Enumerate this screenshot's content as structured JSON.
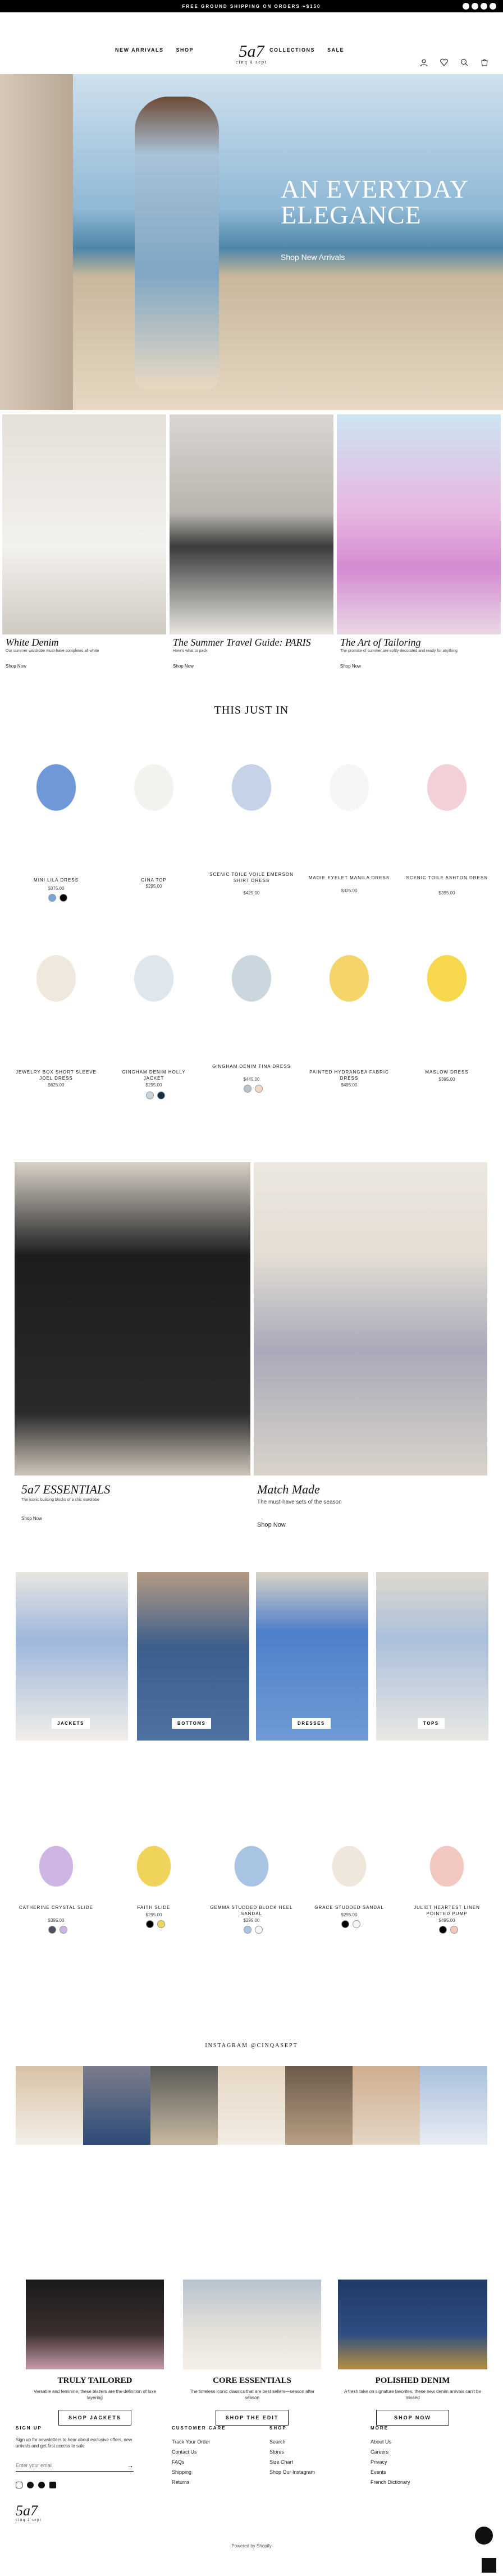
{
  "announcement": "FREE GROUND SHIPPING ON ORDERS +$150",
  "nav_left": [
    "NEW ARRIVALS",
    "SHOP"
  ],
  "nav_right": [
    "COLLECTIONS",
    "SALE"
  ],
  "logo": {
    "main": "5a7",
    "sub": "cinq à sept"
  },
  "header_icons": [
    "account-icon",
    "heart-icon",
    "search-icon",
    "cart-icon"
  ],
  "hero": {
    "title_line1": "AN EVERYDAY",
    "title_line2": "ELEGANCE",
    "cta": "Shop New Arrivals"
  },
  "features": [
    {
      "title": "White Denim",
      "sub": "Our summer wardrobe must-have completes all-white",
      "link": "Shop Now"
    },
    {
      "title": "The Summer Travel Guide: PARIS",
      "sub": "Here's what to pack",
      "link": "Shop Now"
    },
    {
      "title": "The Art of Tailoring",
      "sub": "The promise of summer are softly decorated and ready for anything",
      "link": "Shop Now"
    }
  ],
  "just_in": {
    "title": "THIS JUST IN",
    "row1": [
      {
        "name": "MINI LILA DRESS",
        "price": "$375.00"
      },
      {
        "name": "GINA TOP",
        "price": "$295.00"
      },
      {
        "name": "SCENIC TOILE VOILE EMERSON SHIRT DRESS",
        "price": "$425.00"
      },
      {
        "name": "MADIE EYELET MANILA DRESS",
        "price": "$325.00"
      },
      {
        "name": "SCENIC TOILE ASHTON DRESS",
        "price": "$395.00"
      }
    ],
    "row2": [
      {
        "name": "JEWELRY BOX SHORT SLEEVE JOEL DRESS",
        "price": "$625.00"
      },
      {
        "name": "GINGHAM DENIM HOLLY JACKET",
        "price": "$295.00"
      },
      {
        "name": "GINGHAM DENIM TINA DRESS",
        "price": "$445.00"
      },
      {
        "name": "PAINTED HYDRANGEA FABRIC DRESS",
        "price": "$495.00"
      },
      {
        "name": "MASLOW DRESS",
        "price": "$395.00"
      }
    ]
  },
  "promo": [
    {
      "title": "5a7 ESSENTIALS",
      "sub": "The iconic building blocks of a chic wardrobe",
      "link": "Shop Now"
    },
    {
      "title": "Match Made",
      "sub": "The must-have sets of the season",
      "link": "Shop Now"
    }
  ],
  "categories": [
    "JACKETS",
    "BOTTOMS",
    "DRESSES",
    "TOPS"
  ],
  "shoes": [
    {
      "name": "CATHERINE CRYSTAL SLIDE",
      "price": "$395.00"
    },
    {
      "name": "FAITH SLIDE",
      "price": "$295.00"
    },
    {
      "name": "GEMMA STUDDED BLOCK HEEL SANDAL",
      "price": "$295.00"
    },
    {
      "name": "GRACE STUDDED SANDAL",
      "price": "$295.00"
    },
    {
      "name": "JULIET HEARTEST LINEN POINTED PUMP",
      "price": "$495.00"
    }
  ],
  "instagram": "INSTAGRAM @CINQASEPT",
  "collections": [
    {
      "title": "TRULY TAILORED",
      "sub": "Versatile and feminine, these blazers are the definition of luxe layering",
      "button": "SHOP JACKETS"
    },
    {
      "title": "CORE ESSENTIALS",
      "sub": "The timeless iconic classics that are best sellers—season after season",
      "button": "SHOP THE EDIT"
    },
    {
      "title": "POLISHED DENIM",
      "sub": "A fresh take on signature favorites; these new denim arrivals can't be missed",
      "button": "SHOP NOW"
    }
  ],
  "footer": {
    "signup_head": "SIGN UP",
    "signup_text": "Sign up for newsletters to hear about exclusive offers, new arrivals and get first access to sale",
    "email_placeholder": "Enter your email",
    "cols": [
      {
        "head": "CUSTOMER CARE",
        "links": [
          "Track Your Order",
          "Contact Us",
          "FAQs",
          "Shipping",
          "Returns"
        ]
      },
      {
        "head": "SHOP",
        "links": [
          "Search",
          "Stores",
          "Size Chart",
          "Shop Our Instagram"
        ]
      },
      {
        "head": "MORE",
        "links": [
          "About Us",
          "Careers",
          "Privacy",
          "Events",
          "French Dictionary"
        ]
      }
    ],
    "powered": "Powered by Shopify"
  },
  "colors": {
    "black": "#000000",
    "swatch_blue": "#7da2d6"
  }
}
